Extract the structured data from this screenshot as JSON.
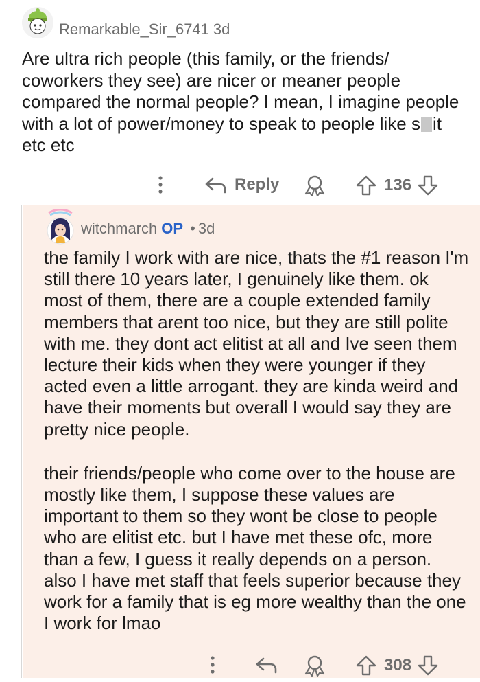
{
  "comment": {
    "username": "Remarkable_Sir_6741",
    "age": "3d",
    "body_before_censor": "Are ultra rich people (this family, or the friends/ coworkers they see) are nicer or meaner people compared the normal people? I mean, I imagine people with a lot of power/money to speak to people like s",
    "body_after_censor": "it etc etc",
    "reply_label": "Reply",
    "score": "136"
  },
  "reply": {
    "username": "witchmarch",
    "op_badge": "OP",
    "separator": "•",
    "age": "3d",
    "paragraph_1": "the family I work with are nice, thats the #1 reason I'm still there 10 years later, I genuinely like them. ok most of them, there are a couple extended family members that arent too nice, but they are still polite with me. they dont act elitist at all and Ive seen them lecture their kids when they were younger if they acted even a little arrogant. they are kinda weird and have their moments but overall I would say they are pretty nice people.",
    "paragraph_2": "their friends/people who come over to the house are mostly like them, I suppose these values are important to them so they wont be close to people who are elitist etc. but I have met these ofc, more than a few, I guess it really depends on a person. also I have met staff that feels superior because they work for a family that is eg more wealthy than the one I work for lmao",
    "score": "308"
  },
  "colors": {
    "reply_background": "#fcefe8",
    "op_badge": "#2a63c8",
    "meta_text": "#6e6e6e"
  },
  "icons": [
    "more-vertical-icon",
    "reply-arrow-icon",
    "award-icon",
    "upvote-icon",
    "downvote-icon",
    "avatar-icon"
  ]
}
